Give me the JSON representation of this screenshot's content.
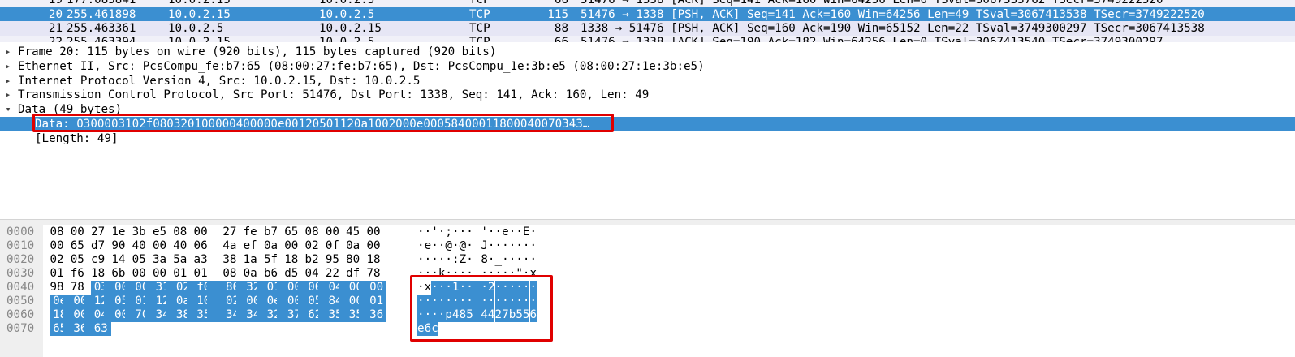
{
  "packet_list": {
    "rows": [
      {
        "no": "19",
        "time": "177.085841",
        "src": "10.0.2.15",
        "dst": "10.0.2.5",
        "proto": "TCP",
        "len": "66",
        "info": "51476 → 1338 [ACK] Seq=141 Ack=160 Win=64256 Len=0 TSval=3067333762 TSecr=3749222520",
        "state": "partial"
      },
      {
        "no": "20",
        "time": "255.461898",
        "src": "10.0.2.15",
        "dst": "10.0.2.5",
        "proto": "TCP",
        "len": "115",
        "info": "51476 → 1338 [PSH, ACK] Seq=141 Ack=160 Win=64256 Len=49 TSval=3067413538 TSecr=3749222520",
        "state": "selected"
      },
      {
        "no": "21",
        "time": "255.463361",
        "src": "10.0.2.5",
        "dst": "10.0.2.15",
        "proto": "TCP",
        "len": "88",
        "info": "1338 → 51476 [PSH, ACK] Seq=160 Ack=190 Win=65152 Len=22 TSval=3749300297 TSecr=3067413538",
        "state": "normal"
      },
      {
        "no": "22",
        "time": "255.463394",
        "src": "10.0.2.15",
        "dst": "10.0.2.5",
        "proto": "TCP",
        "len": "66",
        "info": "51476 → 1338 [ACK] Seq=190 Ack=182 Win=64256 Len=0 TSval=3067413540 TSecr=3749300297",
        "state": "partial"
      }
    ]
  },
  "details": {
    "rows": [
      {
        "arrow": "▸",
        "text": "Frame 20: 115 bytes on wire (920 bits), 115 bytes captured (920 bits)",
        "indent": 0
      },
      {
        "arrow": "▸",
        "text": "Ethernet II, Src: PcsCompu_fe:b7:65 (08:00:27:fe:b7:65), Dst: PcsCompu_1e:3b:e5 (08:00:27:1e:3b:e5)",
        "indent": 0
      },
      {
        "arrow": "▸",
        "text": "Internet Protocol Version 4, Src: 10.0.2.15, Dst: 10.0.2.5",
        "indent": 0
      },
      {
        "arrow": "▸",
        "text": "Transmission Control Protocol, Src Port: 51476, Dst Port: 1338, Seq: 141, Ack: 160, Len: 49",
        "indent": 0
      },
      {
        "arrow": "▾",
        "text": "Data (49 bytes)",
        "indent": 0
      },
      {
        "arrow": "",
        "text": "Data: 0300003102f080320100000400000e00120501120a1002000e00058400011800040070343…",
        "indent": 1,
        "selected": true
      },
      {
        "arrow": "",
        "text": "[Length: 49]",
        "indent": 1
      }
    ]
  },
  "bytes": {
    "offsets": [
      "0000",
      "0010",
      "0020",
      "0030",
      "0040",
      "0050",
      "0060",
      "0070"
    ],
    "hex": [
      [
        "08",
        "00",
        "27",
        "1e",
        "3b",
        "e5",
        "08",
        "00",
        "27",
        "fe",
        "b7",
        "65",
        "08",
        "00",
        "45",
        "00"
      ],
      [
        "00",
        "65",
        "d7",
        "90",
        "40",
        "00",
        "40",
        "06",
        "4a",
        "ef",
        "0a",
        "00",
        "02",
        "0f",
        "0a",
        "00"
      ],
      [
        "02",
        "05",
        "c9",
        "14",
        "05",
        "3a",
        "5a",
        "a3",
        "38",
        "1a",
        "5f",
        "18",
        "b2",
        "95",
        "80",
        "18"
      ],
      [
        "01",
        "f6",
        "18",
        "6b",
        "00",
        "00",
        "01",
        "01",
        "08",
        "0a",
        "b6",
        "d5",
        "04",
        "22",
        "df",
        "78"
      ],
      [
        "98",
        "78",
        "03",
        "00",
        "00",
        "31",
        "02",
        "f0",
        "80",
        "32",
        "01",
        "00",
        "00",
        "04",
        "00",
        "00"
      ],
      [
        "0e",
        "00",
        "12",
        "05",
        "01",
        "12",
        "0a",
        "10",
        "02",
        "00",
        "0e",
        "00",
        "05",
        "84",
        "00",
        "01"
      ],
      [
        "18",
        "00",
        "04",
        "00",
        "70",
        "34",
        "38",
        "35",
        "34",
        "34",
        "32",
        "37",
        "62",
        "35",
        "35",
        "36"
      ],
      [
        "65",
        "36",
        "63"
      ]
    ],
    "ascii": [
      [
        "·",
        "·",
        "'",
        "·",
        ";",
        "·",
        "·",
        "·",
        "'",
        "·",
        "·",
        "e",
        "·",
        "·",
        "E",
        "·"
      ],
      [
        "·",
        "e",
        "·",
        "·",
        "@",
        "·",
        "@",
        "·",
        "J",
        "·",
        "·",
        "·",
        "·",
        "·",
        "·",
        "·"
      ],
      [
        "·",
        "·",
        "·",
        "·",
        "·",
        ":",
        "Z",
        "·",
        "8",
        "·",
        "_",
        "·",
        "·",
        "·",
        "·",
        "·"
      ],
      [
        "·",
        "·",
        "·",
        "k",
        "·",
        "·",
        "·",
        "·",
        "·",
        "·",
        "·",
        "·",
        "·",
        "\"",
        "·",
        "x"
      ],
      [
        "·",
        "x",
        "·",
        "·",
        "·",
        "1",
        "·",
        "·",
        "·",
        "2",
        "·",
        "·",
        "·",
        "·",
        "·",
        "·"
      ],
      [
        "·",
        "·",
        "·",
        "·",
        "·",
        "·",
        "·",
        "·",
        "·",
        "·",
        "·",
        "·",
        "·",
        "·",
        "·",
        "·"
      ],
      [
        "·",
        "·",
        "·",
        "·",
        "p",
        "4",
        "8",
        "5",
        "4",
        "4",
        "2",
        "7",
        "b",
        "5",
        "5",
        "6"
      ],
      [
        "e",
        "6",
        "c"
      ]
    ],
    "highlight_start": 66
  },
  "colors": {
    "selection": "#3b8fd1",
    "annotation": "#e00000"
  }
}
